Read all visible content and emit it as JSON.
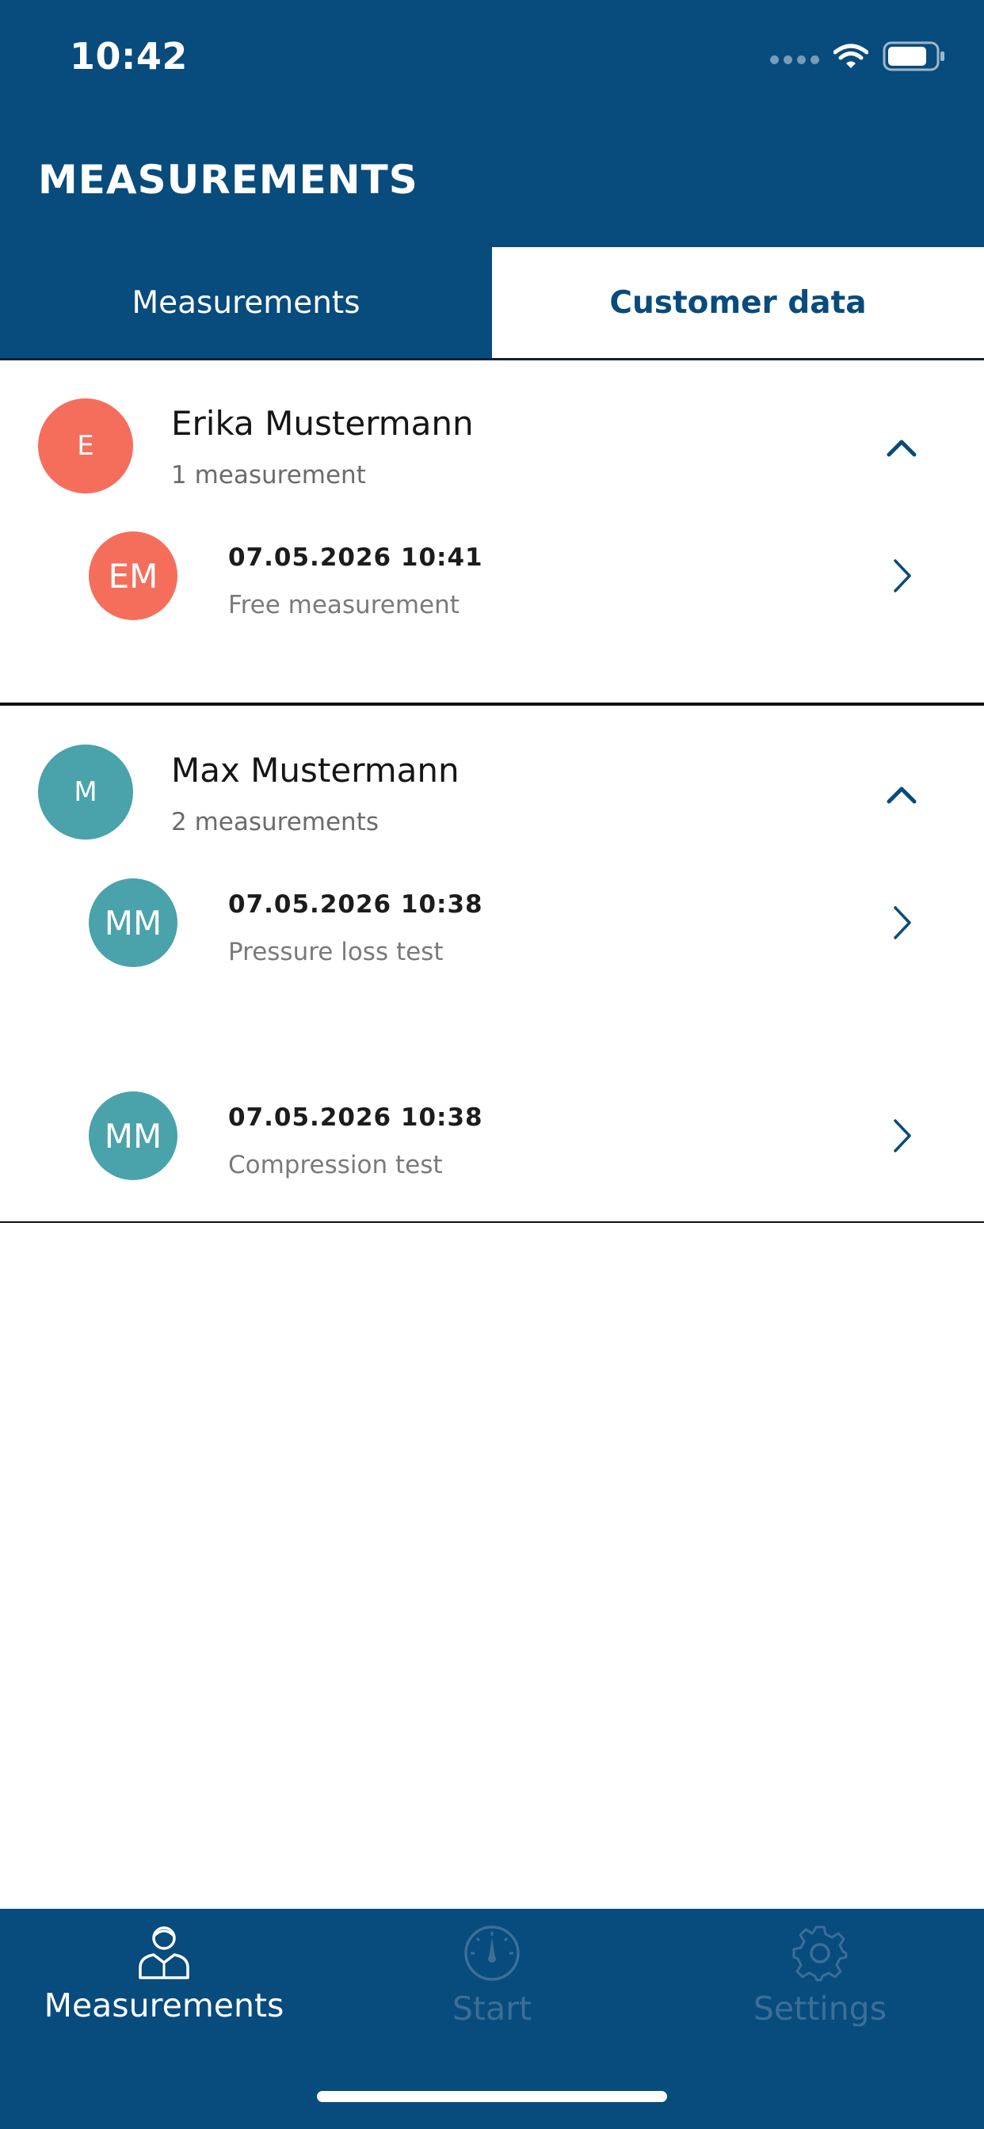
{
  "status_bar": {
    "time": "10:42"
  },
  "header": {
    "title": "MEASUREMENTS"
  },
  "tabs": [
    {
      "label": "Measurements",
      "active": false
    },
    {
      "label": "Customer data",
      "active": true
    }
  ],
  "groups": [
    {
      "initial": "E",
      "name": "Erika Mustermann",
      "count": "1 measurement",
      "color": "#f56e5c",
      "expanded": true,
      "items": [
        {
          "initials": "EM",
          "date": "07.05.2026 10:41",
          "type": "Free measurement"
        }
      ]
    },
    {
      "initial": "M",
      "name": "Max Mustermann",
      "count": "2 measurements",
      "color": "#4aa2ab",
      "expanded": true,
      "items": [
        {
          "initials": "MM",
          "date": "07.05.2026 10:38",
          "type": "Pressure loss test"
        },
        {
          "initials": "MM",
          "date": "07.05.2026 10:38",
          "type": "Compression test"
        }
      ]
    }
  ],
  "bottom_nav": [
    {
      "label": "Measurements",
      "icon": "person-icon",
      "active": true
    },
    {
      "label": "Start",
      "icon": "gauge-icon",
      "active": false
    },
    {
      "label": "Settings",
      "icon": "gear-icon",
      "active": false
    }
  ],
  "colors": {
    "brand": "#084b7d",
    "coral": "#f56e5c",
    "teal": "#4aa2ab",
    "nav_inactive": "#3a6f98"
  }
}
